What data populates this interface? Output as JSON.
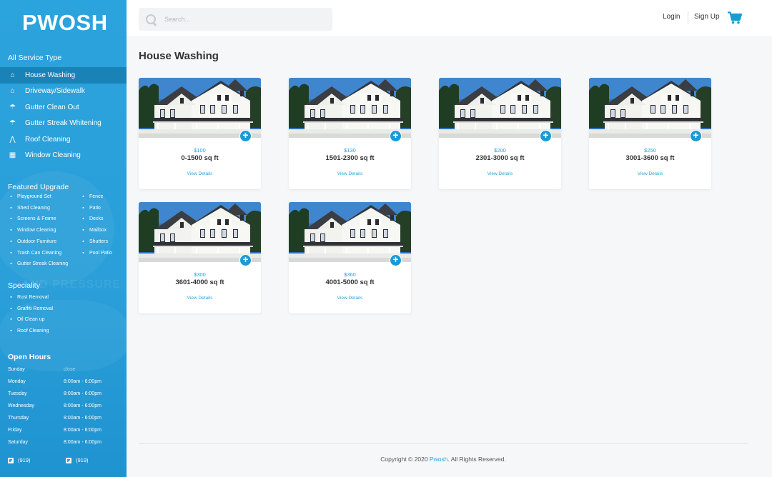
{
  "sidebar": {
    "logo": "PWOSH",
    "service_title": "All Service Type",
    "services": [
      {
        "label": "House Washing",
        "icon": "house-icon",
        "active": true
      },
      {
        "label": "Driveway/Sidewalk",
        "icon": "driveway-icon",
        "active": false
      },
      {
        "label": "Gutter Clean Out",
        "icon": "gutter-icon",
        "active": false
      },
      {
        "label": "Gutter Streak Whitening",
        "icon": "gutter-streak-icon",
        "active": false
      },
      {
        "label": "Roof Cleaning",
        "icon": "roof-icon",
        "active": false
      },
      {
        "label": "Window Cleaning",
        "icon": "window-icon",
        "active": false
      }
    ],
    "featured_title": "Featured Upgrade",
    "featured_left": [
      "Playground Set",
      "Shed Cleaning",
      "Screens & Frame",
      "Window Cleaning",
      "Outdoor Furniture",
      "Trash Can Cleaning",
      "Gutter Streak Cleaning"
    ],
    "featured_right": [
      "Fence",
      "Patio",
      "Decks",
      "Mailbox",
      "Shutters",
      "Pool Patio"
    ],
    "speciality_title": "Speciality",
    "speciality": [
      "Rust Removal",
      "Graffiti Removal",
      "Oil Clean up",
      "Roof Cleaning"
    ],
    "hours_title": "Open Hours",
    "hours": [
      {
        "day": "Sunday",
        "time": "close"
      },
      {
        "day": "Monday",
        "time": "8:00am - 6:00pm"
      },
      {
        "day": "Tuesday",
        "time": "8:00am - 6:00pm"
      },
      {
        "day": "Wednesday",
        "time": "8:00am - 6:00pm"
      },
      {
        "day": "Thursday",
        "time": "8:00am - 6:00pm"
      },
      {
        "day": "Friday",
        "time": "8:00am - 6:00pm"
      },
      {
        "day": "Saturday",
        "time": "8:00am - 6:00pm"
      }
    ],
    "phones": [
      "(919)",
      "(919)"
    ],
    "watermark": "AND PRESSURE"
  },
  "header": {
    "search_placeholder": "Search...",
    "login": "Login",
    "signup": "Sign Up"
  },
  "main": {
    "title": "House Washing",
    "details_label": "View Details",
    "cards": [
      {
        "price": "$100",
        "size": "0-1500 sq ft"
      },
      {
        "price": "$130",
        "size": "1501-2300 sq ft"
      },
      {
        "price": "$200",
        "size": "2301-3000 sq ft"
      },
      {
        "price": "$250",
        "size": "3001-3600 sq ft"
      },
      {
        "price": "$300",
        "size": "3601-4000 sq ft"
      },
      {
        "price": "$360",
        "size": "4001-5000 sq ft"
      }
    ]
  },
  "footer": {
    "prefix": "Copyright © 2020 ",
    "brand": "Pwosh",
    "suffix": ". All Rights Reserved."
  },
  "colors": {
    "accent": "#2ba3dc",
    "sidebar_active": "#1983b8",
    "plus_button": "#1c9ad6"
  }
}
